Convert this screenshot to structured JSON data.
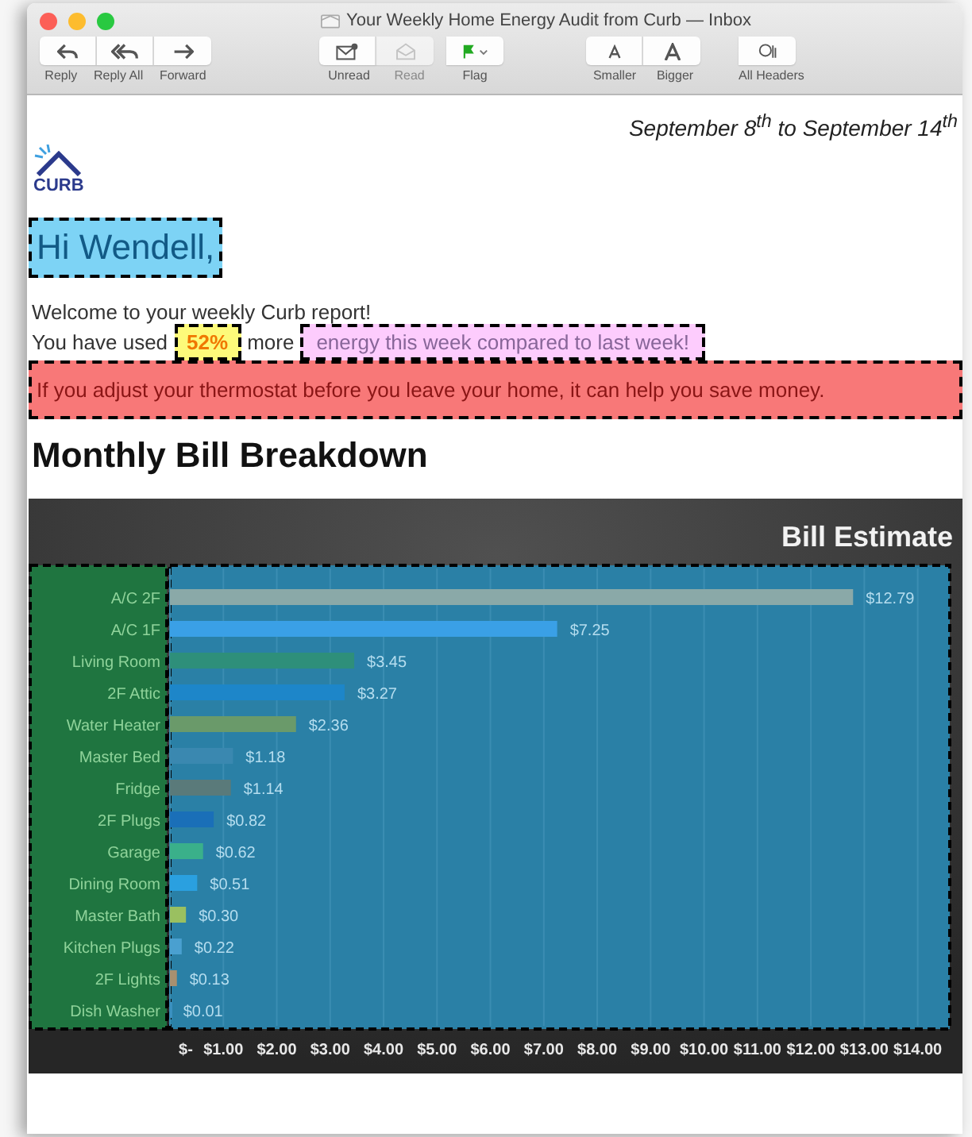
{
  "window": {
    "title": "Your Weekly Home Energy Audit from Curb — Inbox"
  },
  "toolbar": [
    {
      "buttons": [
        {
          "kind": "reply",
          "label": "Reply",
          "disabled": false
        },
        {
          "kind": "reply_all",
          "label": "Reply All",
          "disabled": false
        },
        {
          "kind": "forward",
          "label": "Forward",
          "disabled": false
        }
      ]
    },
    {
      "buttons": [
        {
          "kind": "unread",
          "label": "Unread",
          "disabled": false
        },
        {
          "kind": "read",
          "label": "Read",
          "disabled": true
        }
      ]
    },
    {
      "buttons": [
        {
          "kind": "flag",
          "label": "Flag",
          "disabled": false
        }
      ]
    },
    {
      "buttons": [
        {
          "kind": "smaller",
          "label": "Smaller",
          "disabled": false
        },
        {
          "kind": "bigger",
          "label": "Bigger",
          "disabled": false
        }
      ]
    },
    {
      "buttons": [
        {
          "kind": "headers",
          "label": "All Headers",
          "disabled": false
        }
      ]
    }
  ],
  "email": {
    "date_range": "September 8$^{th}$ to September 14$^{th}$",
    "logo_text": "CURB",
    "greeting": "Hi Wendell,",
    "intro": "Welcome to your weekly Curb report!",
    "usage_line": [
      {
        "kind": "plain",
        "text": "You have used"
      },
      {
        "kind": "value",
        "text": "52%"
      },
      {
        "kind": "plain",
        "text": "more"
      },
      {
        "kind": "callout",
        "text": "energy this week compared to last week!"
      }
    ],
    "tip": "If you adjust your thermostat before you leave your home, it can help you save money.",
    "heading": "Monthly Bill Breakdown",
    "chart_data": {
      "type": "bar",
      "orientation": "horizontal",
      "title": "Bill Estimate",
      "categories": [
        "A/C 2F",
        "A/C 1F",
        "Living Room",
        "2F Attic",
        "Water Heater",
        "Master Bed",
        "Fridge",
        "2F Plugs",
        "Garage",
        "Dining Room",
        "Master Bath",
        "Kitchen Plugs",
        "2F Lights",
        "Dish Washer"
      ],
      "values": [
        12.79,
        7.25,
        3.45,
        3.27,
        2.36,
        1.18,
        1.14,
        0.82,
        0.62,
        0.51,
        0.3,
        0.22,
        0.13,
        0.01
      ],
      "value_labels": [
        "$12.79",
        "$7.25",
        "$3.45",
        "$3.27",
        "$2.36",
        "$1.18",
        "$1.14",
        "$0.82",
        "$0.62",
        "$0.51",
        "$0.30",
        "$0.22",
        "$0.13",
        "$0.01"
      ],
      "xlim": [
        0,
        14.6
      ],
      "grid": true,
      "xticks": [
        {
          "value": 0,
          "label": "$-"
        },
        {
          "value": 1,
          "label": "$1.00"
        },
        {
          "value": 2,
          "label": "$2.00"
        },
        {
          "value": 3,
          "label": "$3.00"
        },
        {
          "value": 4,
          "label": "$4.00"
        },
        {
          "value": 5,
          "label": "$5.00"
        },
        {
          "value": 6,
          "label": "$6.00"
        },
        {
          "value": 7,
          "label": "$7.00"
        },
        {
          "value": 8,
          "label": "$8.00"
        },
        {
          "value": 9,
          "label": "$9.00"
        },
        {
          "value": 10,
          "label": "$10.00"
        },
        {
          "value": 11,
          "label": "$11.00"
        },
        {
          "value": 12,
          "label": "$12.00"
        },
        {
          "value": 13,
          "label": "$13.00"
        },
        {
          "value": 14,
          "label": "$14.00"
        }
      ]
    }
  }
}
